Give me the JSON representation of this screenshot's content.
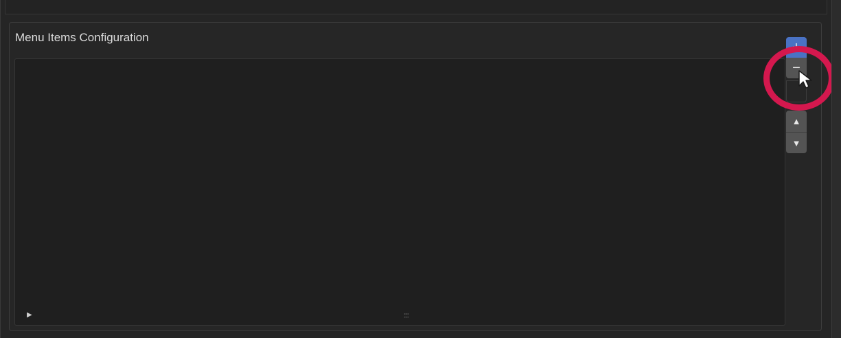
{
  "section": {
    "title": "Menu Items Configuration"
  },
  "list": {
    "expand_glyph": "▶",
    "grip_glyph": "::::"
  },
  "buttons": {
    "add_glyph": "+",
    "remove_glyph": "−",
    "move_up_glyph": "▲",
    "move_down_glyph": "▼"
  },
  "colors": {
    "background": "#252525",
    "list_background": "#1f1f1f",
    "add_button": "#4a72c4",
    "secondary_button": "#545454",
    "highlight_ring": "#d4184e"
  },
  "icons": [
    "expand-arrow-icon",
    "resize-grip-icon",
    "plus-icon",
    "minus-icon",
    "arrow-up-icon",
    "arrow-down-icon",
    "cursor-icon"
  ]
}
